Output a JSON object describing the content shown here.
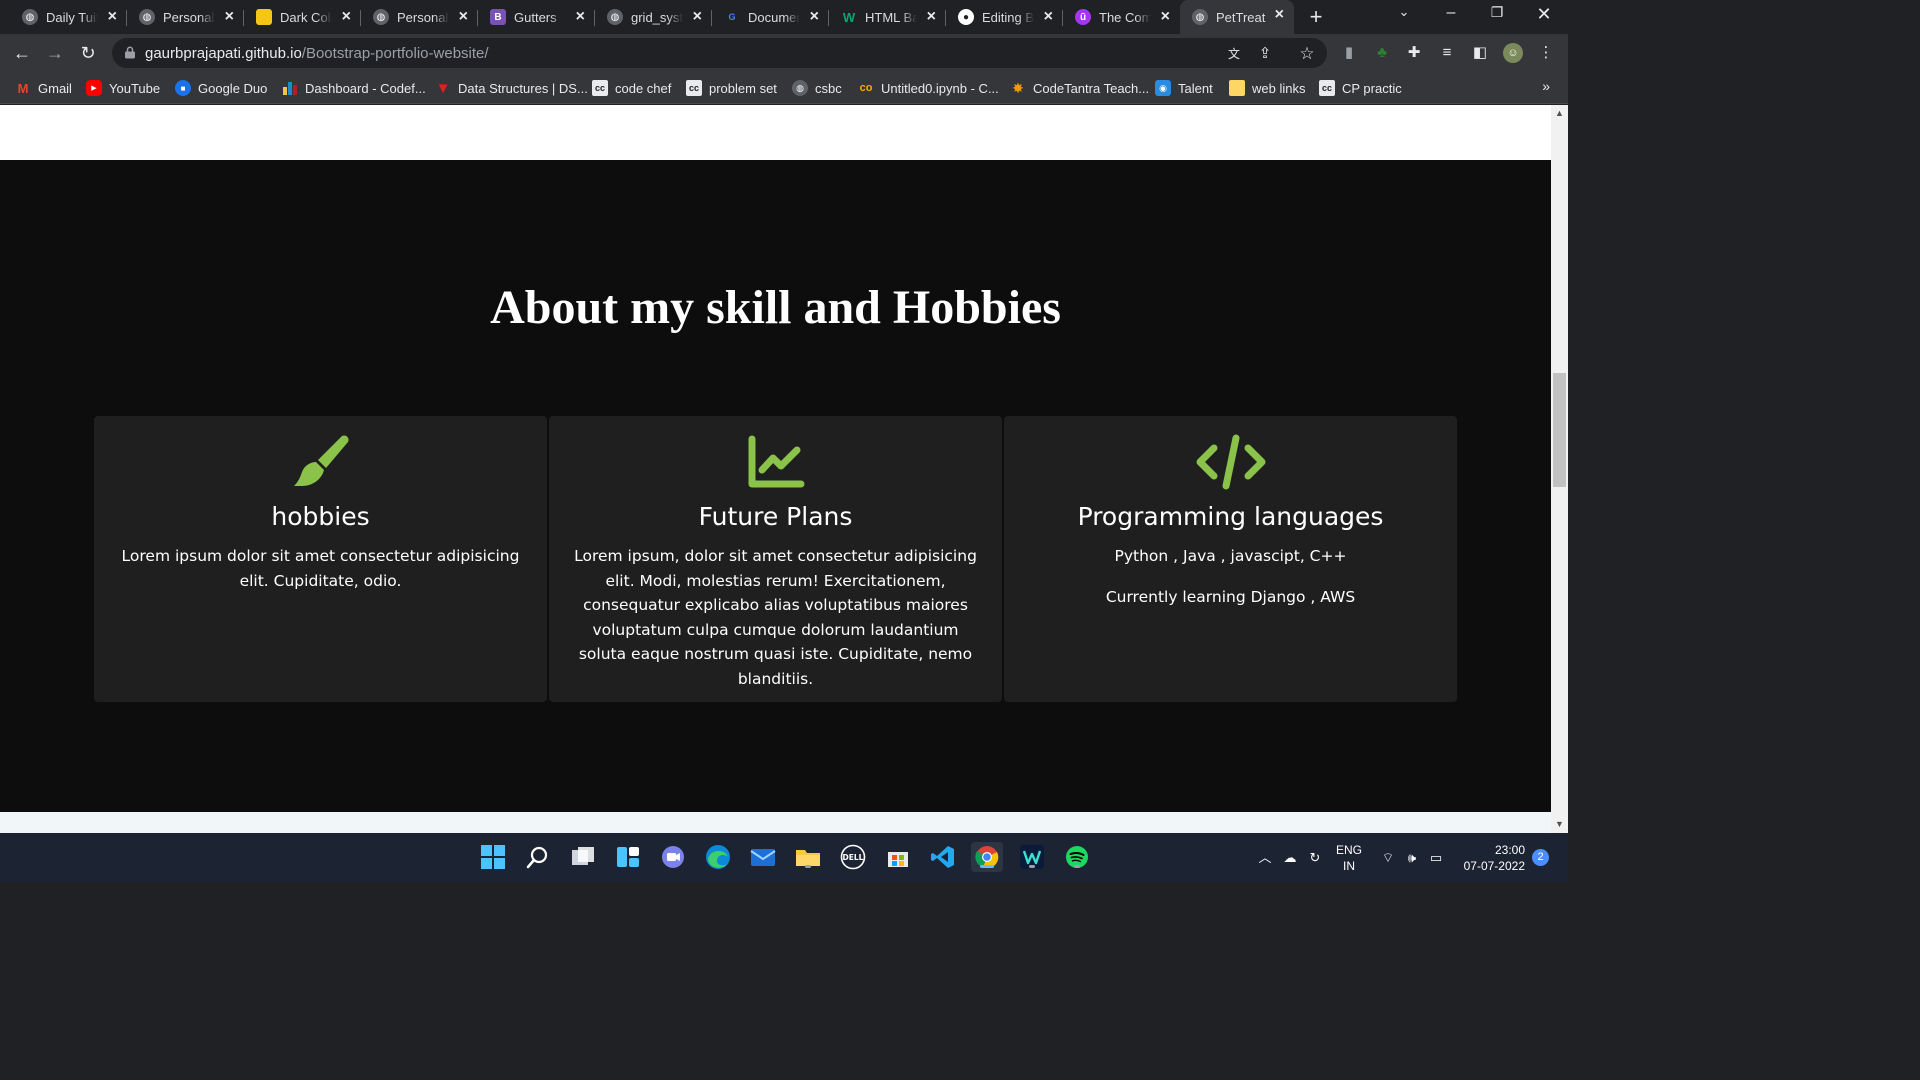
{
  "browser": {
    "tabs": [
      {
        "title": "Daily Tuit",
        "icon": "globe-icon",
        "color": "#5f6368"
      },
      {
        "title": "Personal",
        "icon": "globe-icon",
        "color": "#5f6368"
      },
      {
        "title": "Dark Colo",
        "icon": "colors-icon",
        "color": "#f5c518"
      },
      {
        "title": "Personal",
        "icon": "globe-icon",
        "color": "#5f6368"
      },
      {
        "title": "Gutters",
        "icon": "bootstrap-icon",
        "color": "#7952b3"
      },
      {
        "title": "grid_syste",
        "icon": "globe-icon",
        "color": "#5f6368"
      },
      {
        "title": "Documen",
        "icon": "docs-icon",
        "color": "#4285f4"
      },
      {
        "title": "HTML Ba",
        "icon": "w3schools-icon",
        "color": "#04aa6d"
      },
      {
        "title": "Editing B",
        "icon": "github-icon",
        "color": "#ffffff"
      },
      {
        "title": "The Com",
        "icon": "udemy-icon",
        "color": "#a435f0"
      },
      {
        "title": "PetTreat",
        "icon": "globe-icon",
        "color": "#5f6368",
        "active": true
      }
    ],
    "url_host": "gaurbprajapati.github.io",
    "url_path": "/Bootstrap-portfolio-website/",
    "bookmarks": [
      {
        "label": "Gmail",
        "icon": "gmail-icon",
        "color": "#ea4335"
      },
      {
        "label": "YouTube",
        "icon": "youtube-icon",
        "color": "#ff0000"
      },
      {
        "label": "Google Duo",
        "icon": "duo-icon",
        "color": "#1a73e8"
      },
      {
        "label": "Dashboard - Codef...",
        "icon": "codeforces-icon",
        "color": "#1f8acb"
      },
      {
        "label": "Data Structures | DS...",
        "icon": "gfg-icon",
        "color": "#e02020"
      },
      {
        "label": "code chef",
        "icon": "codechef-icon",
        "color": "#5b4638"
      },
      {
        "label": "problem set",
        "icon": "codechef-icon",
        "color": "#5b4638"
      },
      {
        "label": "csbc",
        "icon": "globe-icon",
        "color": "#5f6368"
      },
      {
        "label": "Untitled0.ipynb - C...",
        "icon": "colab-icon",
        "color": "#f9ab00"
      },
      {
        "label": "CodeTantra Teach...",
        "icon": "codetantra-icon",
        "color": "#f29900"
      },
      {
        "label": "Talent",
        "icon": "talent-icon",
        "color": "#2a8ce0"
      },
      {
        "label": "web links",
        "icon": "folder-icon",
        "color": "#fdd663"
      },
      {
        "label": "CP practic",
        "icon": "codechef-icon",
        "color": "#5b4638"
      }
    ],
    "bookmarks_more": "»"
  },
  "page": {
    "section_title": "About my skill and Hobbies",
    "accent_color": "#8bc34a",
    "cards": [
      {
        "icon": "paintbrush-icon",
        "title": "hobbies",
        "paragraphs": [
          "Lorem ipsum dolor sit amet consectetur adipisicing elit. Cupiditate, odio."
        ]
      },
      {
        "icon": "chart-line-icon",
        "title": "Future Plans",
        "paragraphs": [
          "Lorem ipsum, dolor sit amet consectetur adipisicing elit. Modi, molestias rerum! Exercitationem, consequatur explicabo alias voluptatibus maiores voluptatum culpa cumque dolorum laudantium soluta eaque nostrum quasi iste. Cupiditate, nemo blanditiis."
        ]
      },
      {
        "icon": "code-icon",
        "title": "Programming languages",
        "paragraphs": [
          "Python , Java , javascipt, C++",
          "Currently learning Django , AWS"
        ]
      }
    ]
  },
  "taskbar": {
    "apps": [
      "windows-start-icon",
      "search-icon",
      "task-view-icon",
      "widgets-icon",
      "teams-chat-icon",
      "edge-icon",
      "mail-icon",
      "file-explorer-icon",
      "dell-icon",
      "store-icon",
      "vscode-icon",
      "chrome-icon",
      "wondershare-icon",
      "spotify-icon"
    ],
    "lang_line1": "ENG",
    "lang_line2": "IN",
    "time": "23:00",
    "date": "07-07-2022",
    "notifications": "2"
  }
}
